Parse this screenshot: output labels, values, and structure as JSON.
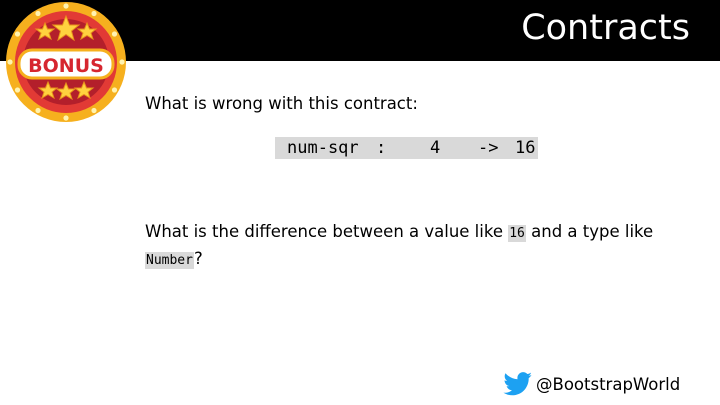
{
  "header": {
    "title": "Contracts"
  },
  "badge": {
    "text": "BONUS",
    "colors": {
      "rim": "#f6b01e",
      "ring": "#e23a35",
      "center": "#b31f2b",
      "star": "#ffd23f"
    }
  },
  "questions": {
    "q1": "What is wrong with this contract:",
    "contract": {
      "name": "num-sqr",
      "colon": ":",
      "domain": "4",
      "arrow": "->",
      "range": "16"
    },
    "q2": {
      "before": "What is the difference between a value like ",
      "value": "16",
      "middle": " and a type like ",
      "type": "Number",
      "after": "?"
    }
  },
  "footer": {
    "handle": "@BootstrapWorld",
    "icon": "twitter-bird-icon",
    "icon_color": "#1da1f2"
  }
}
